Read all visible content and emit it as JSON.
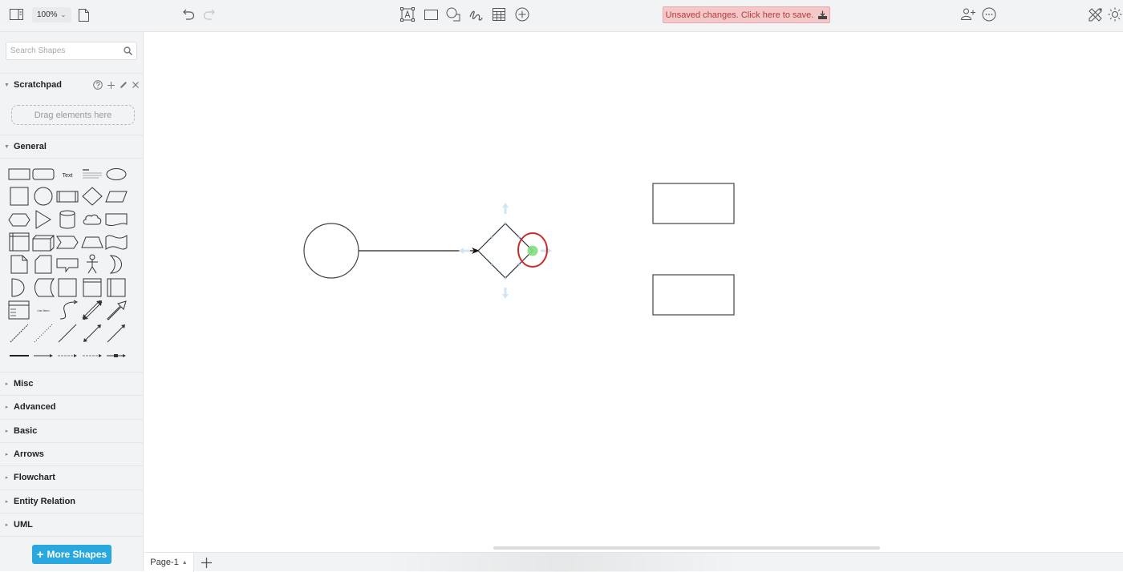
{
  "toolbar": {
    "zoom_level": "100%",
    "save_banner": "Unsaved changes. Click here to save.",
    "icons": [
      "sidebar-toggle-icon",
      "page-icon",
      "undo-icon",
      "redo-icon",
      "text-icon",
      "rectangle-icon",
      "shapes-icon",
      "freehand-icon",
      "table-icon",
      "insert-plus-icon",
      "share-user-icon",
      "more-icon",
      "format-tools-icon",
      "theme-sun-icon"
    ]
  },
  "sidebar": {
    "search_placeholder": "Search Shapes",
    "scratchpad": {
      "label": "Scratchpad",
      "drop_hint": "Drag elements here"
    },
    "general": {
      "label": "General",
      "shapes": [
        "rectangle",
        "rounded-rectangle",
        "text",
        "textbox",
        "ellipse",
        "square",
        "circle",
        "process",
        "diamond",
        "parallelogram",
        "hexagon",
        "triangle",
        "cylinder",
        "cloud",
        "document",
        "internal-storage",
        "cube",
        "step",
        "trapezoid",
        "tape",
        "note",
        "card",
        "callout",
        "actor",
        "or",
        "and",
        "data-storage",
        "square-2",
        "container",
        "vertical-container",
        "list",
        "list-item",
        "curve",
        "bidirectional-arrow",
        "arrow",
        "dashed-line",
        "dotted-line",
        "line",
        "bidirectional-connector",
        "directional-connector",
        "link",
        "connector-with-label",
        "connector-with-2-labels",
        "connector-with-3-labels",
        "connector-with-symbol"
      ],
      "text_label": "Text",
      "list_item_label": "List Item"
    },
    "sections": [
      "Misc",
      "Advanced",
      "Basic",
      "Arrows",
      "Flowchart",
      "Entity Relation",
      "UML"
    ],
    "more_shapes_label": "More Shapes"
  },
  "canvas": {
    "shapes": [
      {
        "type": "circle",
        "name": "circle-shape"
      },
      {
        "type": "edge",
        "name": "connector-arrow",
        "from": "circle-shape",
        "to": "diamond-shape"
      },
      {
        "type": "diamond",
        "name": "diamond-shape",
        "selected": true
      },
      {
        "type": "rectangle",
        "name": "rectangle-top"
      },
      {
        "type": "rectangle",
        "name": "rectangle-bottom"
      }
    ],
    "highlight_color": "#cc2a2a",
    "hover_point_color": "#7ee07e",
    "handle_color": "#cfe6f5"
  },
  "footer": {
    "page_tab": "Page-1"
  }
}
